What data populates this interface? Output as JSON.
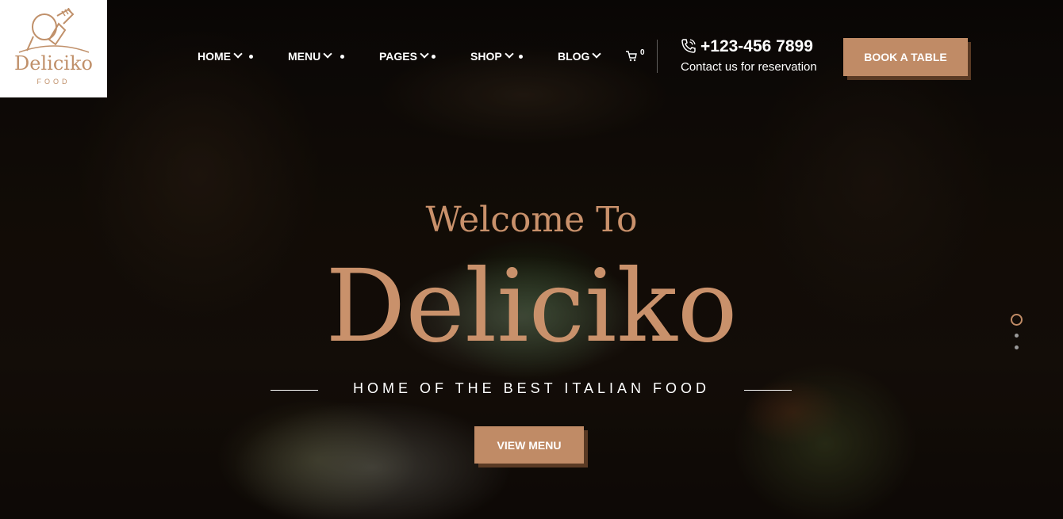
{
  "logo": {
    "name": "Deliciko",
    "sub": "FOOD"
  },
  "nav": {
    "items": [
      {
        "label": "HOME"
      },
      {
        "label": "MENU"
      },
      {
        "label": "PAGES"
      },
      {
        "label": "SHOP"
      },
      {
        "label": "BLOG"
      }
    ]
  },
  "cart": {
    "count": "0"
  },
  "contact": {
    "phone": "+123-456 7899",
    "note": "Contact us for reservation"
  },
  "cta": {
    "book": "BOOK A TABLE"
  },
  "hero": {
    "welcome": "Welcome To",
    "brand": "Deliciko",
    "tagline": "HOME OF THE BEST ITALIAN FOOD",
    "button": "VIEW MENU"
  },
  "slider": {
    "slides": 3,
    "active": 1
  },
  "colors": {
    "accent": "#c08b66",
    "text": "#ffffff"
  }
}
